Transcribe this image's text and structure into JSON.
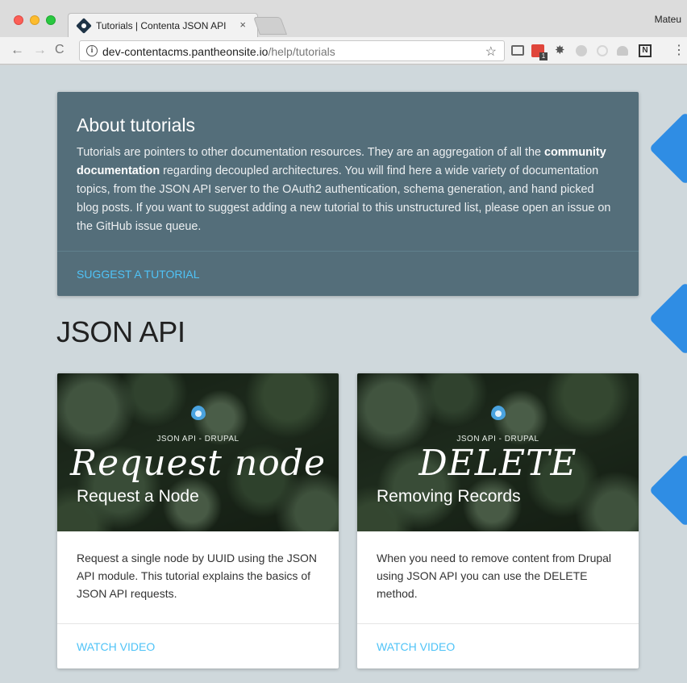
{
  "browser": {
    "tab_title": "Tutorials | Contenta JSON API",
    "tab_close": "×",
    "profile_name": "Mateu",
    "url_host": "dev-contentacms.pantheonsite.io",
    "url_path": "/help/tutorials",
    "icons": {
      "back": "←",
      "forward": "→",
      "reload": "C",
      "info": "i",
      "star": "☆",
      "gear": "✸",
      "menu": "⋮",
      "notion": "N"
    }
  },
  "about": {
    "title": "About tutorials",
    "text_before_bold": "Tutorials are pointers to other documentation resources. They are an aggregation of all the ",
    "bold_text": "community documentation",
    "text_after_bold": " regarding decoupled architectures. You will find here a wide variety of documentation topics, from the JSON API server to the OAuth2 authentication, schema generation, and hand picked blog posts. If you want to suggest adding a new tutorial to this unstructured list, please open an issue on the GitHub issue queue.",
    "suggest_label": "SUGGEST A TUTORIAL"
  },
  "section": {
    "heading": "JSON API"
  },
  "cards": [
    {
      "kicker": "JSON API - DRUPAL",
      "script_title": "Request node",
      "caption": "Request a Node",
      "description": "Request a single node by UUID using the JSON API module. This tutorial explains the basics of JSON API requests.",
      "action_label": "WATCH VIDEO"
    },
    {
      "kicker": "JSON API - DRUPAL",
      "script_title": "DELETE",
      "caption": "Removing Records",
      "description": "When you need to remove content from Drupal using JSON API you can use the DELETE method.",
      "action_label": "WATCH VIDEO"
    }
  ],
  "colors": {
    "page_background": "#cfd8dc",
    "about_card": "#546e7a",
    "link_accent": "#4fc3f7",
    "side_marker": "#2f8de4"
  }
}
